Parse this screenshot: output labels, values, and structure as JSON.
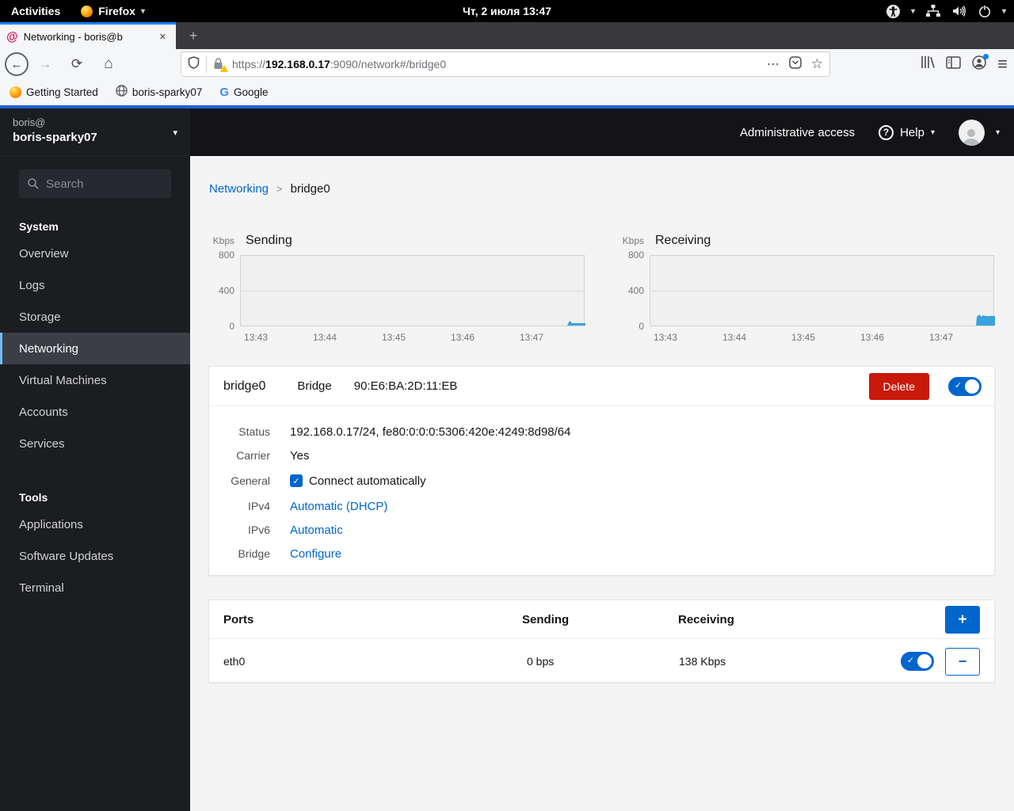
{
  "desktop": {
    "activities_label": "Activities",
    "app_name": "Firefox",
    "clock": "Чт, 2 июля  13:47"
  },
  "browser": {
    "tab_title": "Networking - boris@b",
    "url_scheme": "https://",
    "url_host": "192.168.0.17",
    "url_path": ":9090/network#/bridge0",
    "bookmarks": [
      {
        "label": "Getting Started"
      },
      {
        "label": "boris-sparky07"
      },
      {
        "label": "Google"
      }
    ]
  },
  "sidebar": {
    "user": "boris@",
    "hostname": "boris-sparky07",
    "search_placeholder": "Search",
    "sections": [
      {
        "title": "System",
        "items": [
          {
            "label": "Overview",
            "active": false
          },
          {
            "label": "Logs",
            "active": false
          },
          {
            "label": "Storage",
            "active": false
          },
          {
            "label": "Networking",
            "active": true
          },
          {
            "label": "Virtual Machines",
            "active": false
          },
          {
            "label": "Accounts",
            "active": false
          },
          {
            "label": "Services",
            "active": false
          }
        ]
      },
      {
        "title": "Tools",
        "items": [
          {
            "label": "Applications",
            "active": false
          },
          {
            "label": "Software Updates",
            "active": false
          },
          {
            "label": "Terminal",
            "active": false
          }
        ]
      }
    ]
  },
  "masthead": {
    "admin_access_label": "Administrative access",
    "help_label": "Help"
  },
  "breadcrumb": {
    "parent": "Networking",
    "separator": ">",
    "current": "bridge0"
  },
  "charts": [
    {
      "title": "Sending",
      "unit": "Kbps",
      "yticks": [
        "800",
        "400",
        "0"
      ],
      "xticks": [
        "13:43",
        "13:44",
        "13:45",
        "13:46",
        "13:47"
      ]
    },
    {
      "title": "Receiving",
      "unit": "Kbps",
      "yticks": [
        "800",
        "400",
        "0"
      ],
      "xticks": [
        "13:43",
        "13:44",
        "13:45",
        "13:46",
        "13:47"
      ]
    }
  ],
  "chart_data": [
    {
      "type": "area",
      "title": "Sending",
      "ylabel": "Kbps",
      "ylim": [
        0,
        800
      ],
      "xticks": [
        "13:43",
        "13:44",
        "13:45",
        "13:46",
        "13:47"
      ],
      "grid": "horizontal at 400",
      "x": [
        "13:43",
        "13:44",
        "13:45",
        "13:46",
        "13:47",
        "13:47:40",
        "13:47:50"
      ],
      "values": [
        0,
        0,
        0,
        0,
        0,
        45,
        25
      ],
      "note": "flat at 0 Kbps, small transmit blip (~25-45 Kbps) in final seconds"
    },
    {
      "type": "area",
      "title": "Receiving",
      "ylabel": "Kbps",
      "ylim": [
        0,
        800
      ],
      "xticks": [
        "13:43",
        "13:44",
        "13:45",
        "13:46",
        "13:47"
      ],
      "grid": "horizontal at 400",
      "x": [
        "13:43",
        "13:44",
        "13:45",
        "13:46",
        "13:47",
        "13:47:35",
        "13:47:50"
      ],
      "values": [
        0,
        0,
        0,
        0,
        0,
        120,
        138
      ],
      "note": "flat at 0 Kbps, receive activity (~100-138 Kbps) in final seconds"
    }
  ],
  "interface": {
    "name": "bridge0",
    "type": "Bridge",
    "mac": "90:E6:BA:2D:11:EB",
    "delete_label": "Delete",
    "enabled": true,
    "details": [
      {
        "label": "Status",
        "value": "192.168.0.17/24, fe80:0:0:0:5306:420e:4249:8d98/64",
        "kind": "text"
      },
      {
        "label": "Carrier",
        "value": "Yes",
        "kind": "text"
      },
      {
        "label": "General",
        "value": "Connect automatically",
        "kind": "checkbox",
        "checked": true
      },
      {
        "label": "IPv4",
        "value": "Automatic (DHCP)",
        "kind": "link"
      },
      {
        "label": "IPv6",
        "value": "Automatic",
        "kind": "link"
      },
      {
        "label": "Bridge",
        "value": "Configure",
        "kind": "link"
      }
    ]
  },
  "ports": {
    "title": "Ports",
    "columns": [
      "Sending",
      "Receiving"
    ],
    "rows": [
      {
        "name": "eth0",
        "sending": "0 bps",
        "receiving": "138 Kbps",
        "enabled": true
      }
    ]
  },
  "colors": {
    "accent": "#0066cc",
    "danger": "#c9190b",
    "chart_fill": "#3aa2dc",
    "nav_active_indicator": "#73bcf7",
    "tab_indicator": "#0a84ff",
    "page_accent_line": "#1e62d9"
  },
  "glyphs": {
    "caret": "▾",
    "close": "✕",
    "new_tab": "+",
    "back": "←",
    "forward": "→",
    "reload": "⟳",
    "home": "⌂",
    "star": "☆",
    "more": "⋯",
    "menu": "≡",
    "check": "✓",
    "plus": "+",
    "minus": "−",
    "question": "?",
    "swirl": "@"
  }
}
